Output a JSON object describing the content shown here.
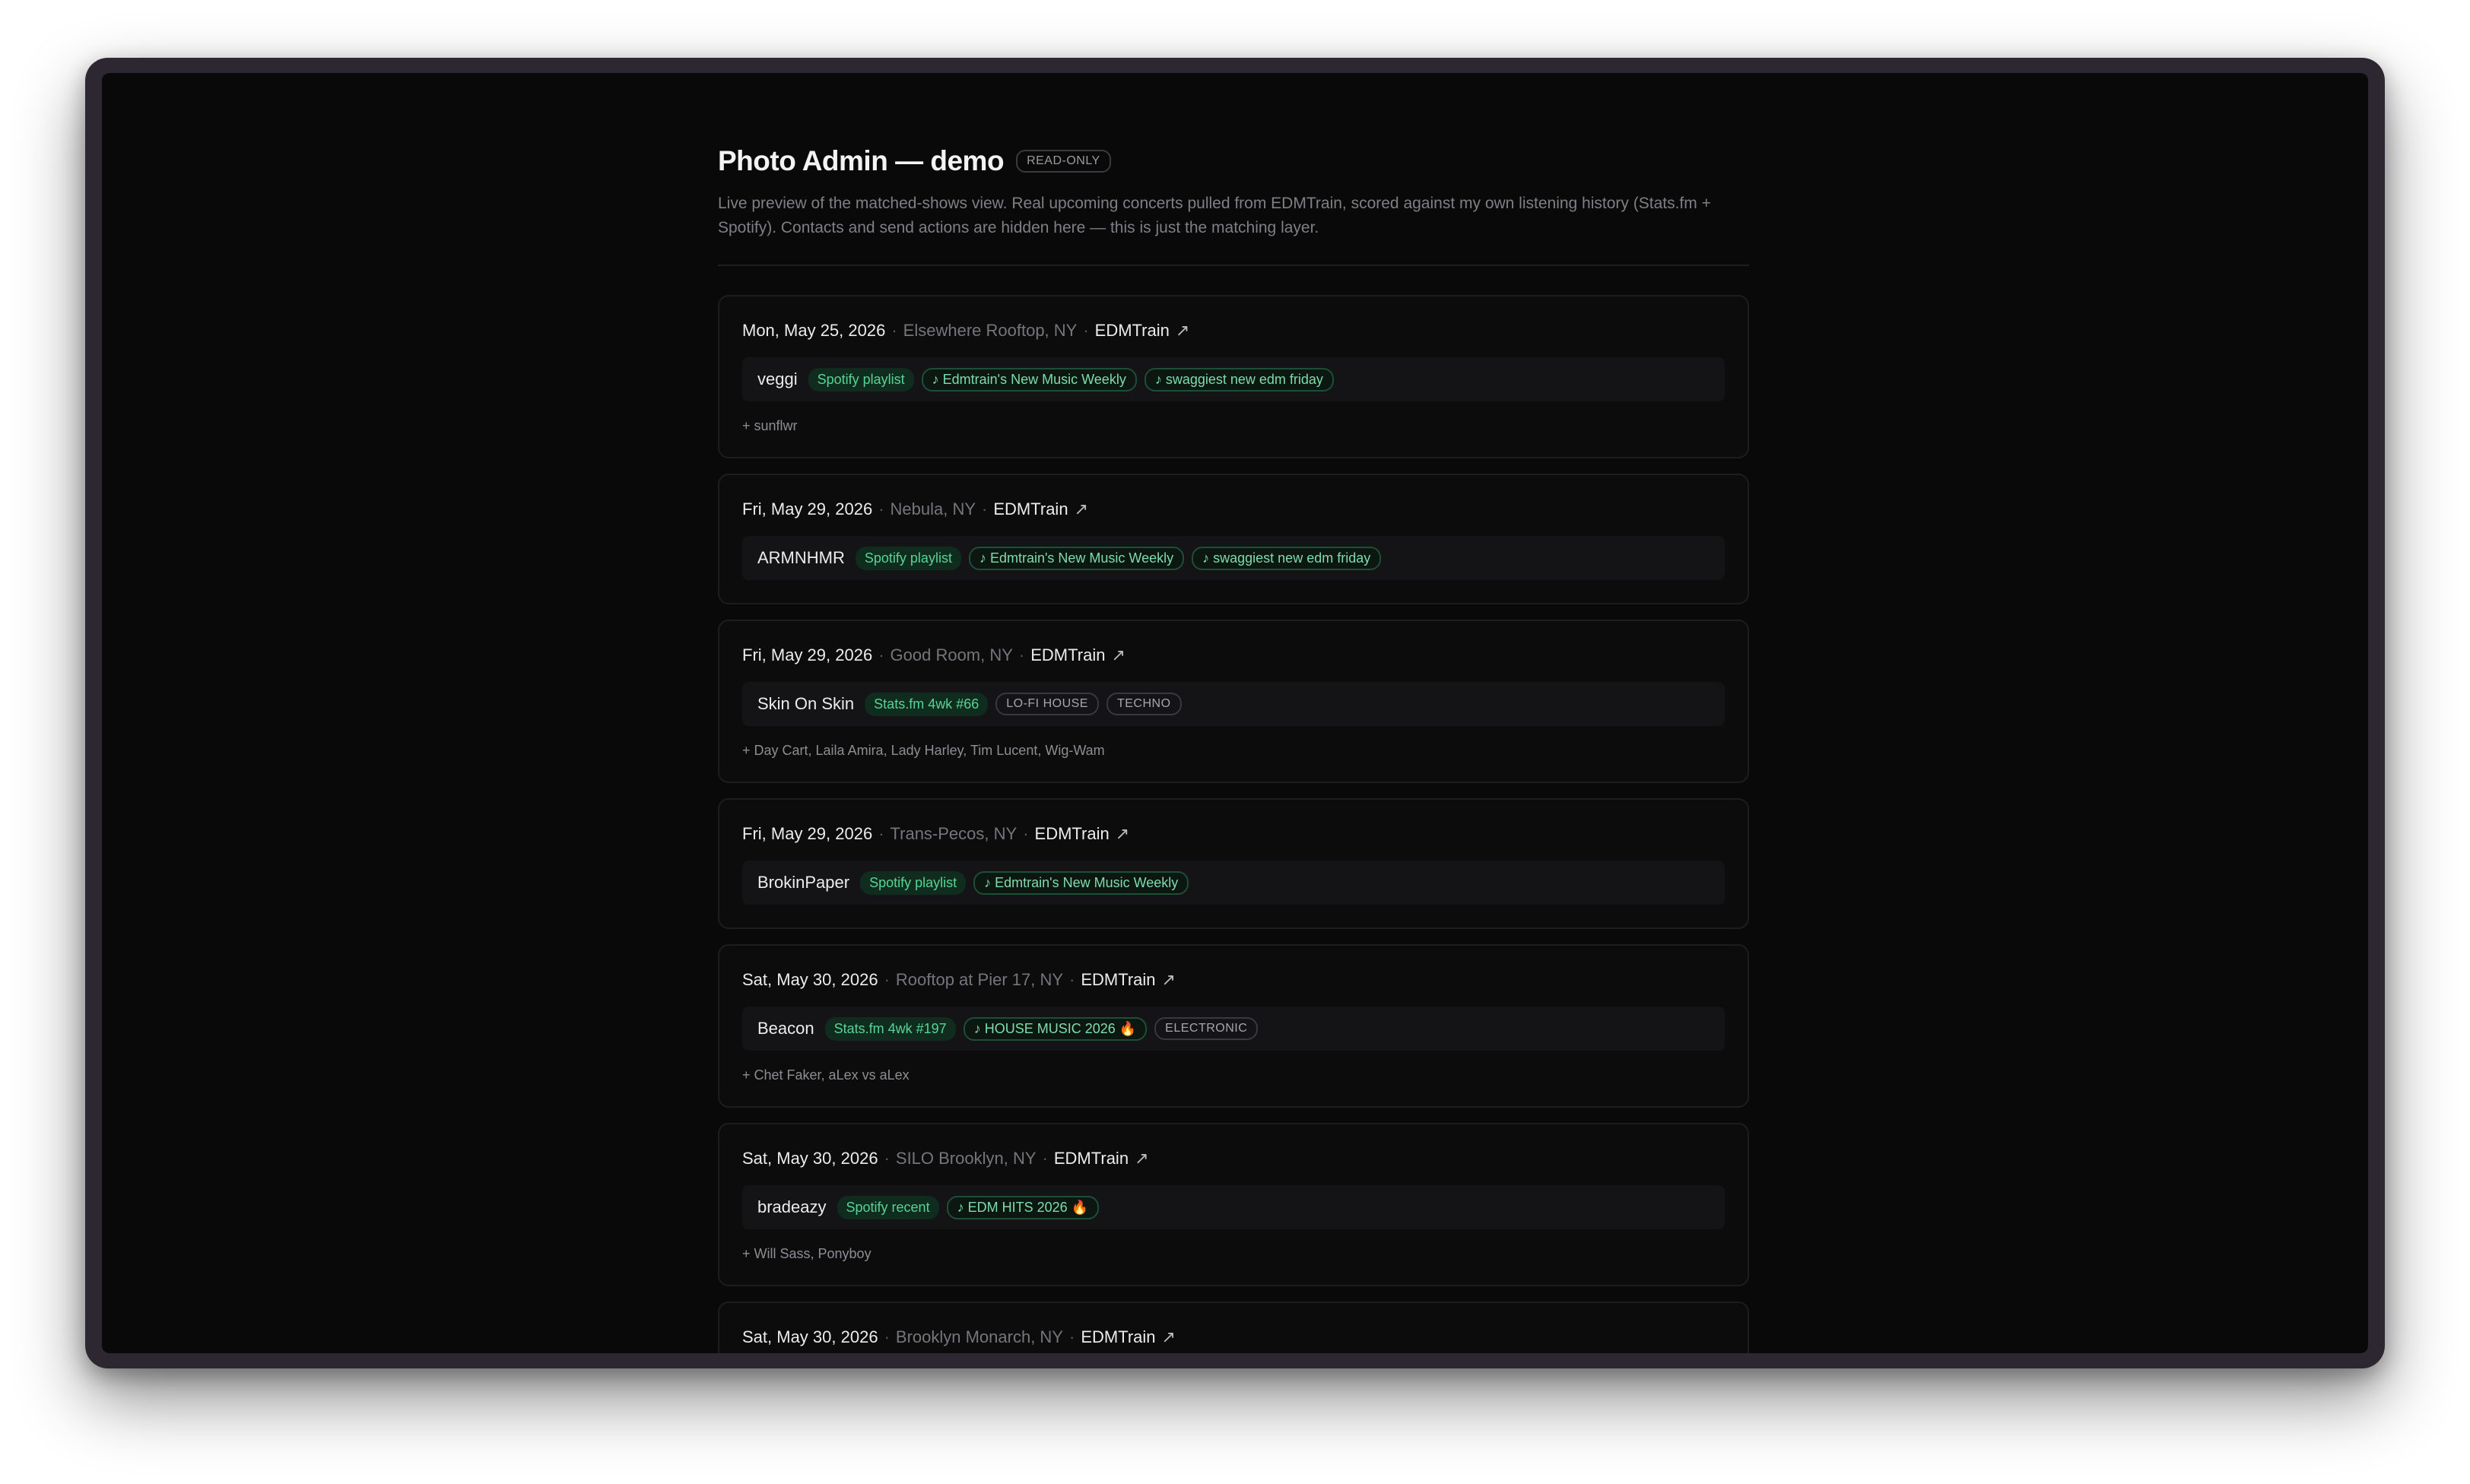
{
  "header": {
    "title": "Photo Admin — demo",
    "badge": "READ-ONLY",
    "description": "Live preview of the matched-shows view. Real upcoming concerts pulled from EDMTrain, scored against my own listening history (Stats.fm + Spotify). Contacts and send actions are hidden here — this is just the matching layer."
  },
  "icons": {
    "external_link": "external-link-icon",
    "note": "music-note-icon"
  },
  "colors": {
    "background": "#09090a",
    "accent_green": "#57d495"
  },
  "shows": [
    {
      "date": "Mon, May 25, 2026",
      "venue": "Elsewhere Rooftop, NY",
      "source": "EDMTrain",
      "link_glyph": "↗",
      "artist": "veggi",
      "tags": [
        {
          "kind": "src-tag",
          "text": "Spotify playlist"
        },
        {
          "kind": "pl-tag",
          "text": "♪ Edmtrain's New Music Weekly"
        },
        {
          "kind": "pl-tag",
          "text": "♪ swaggiest new edm friday"
        }
      ],
      "extra": "+ sunflwr"
    },
    {
      "date": "Fri, May 29, 2026",
      "venue": "Nebula, NY",
      "source": "EDMTrain",
      "link_glyph": "↗",
      "artist": "ARMNHMR",
      "tags": [
        {
          "kind": "src-tag",
          "text": "Spotify playlist"
        },
        {
          "kind": "pl-tag",
          "text": "♪ Edmtrain's New Music Weekly"
        },
        {
          "kind": "pl-tag",
          "text": "♪ swaggiest new edm friday"
        }
      ],
      "extra": ""
    },
    {
      "date": "Fri, May 29, 2026",
      "venue": "Good Room, NY",
      "source": "EDMTrain",
      "link_glyph": "↗",
      "artist": "Skin On Skin",
      "tags": [
        {
          "kind": "src-tag",
          "text": "Stats.fm 4wk #66"
        },
        {
          "kind": "genre",
          "text": "LO-FI HOUSE"
        },
        {
          "kind": "genre",
          "text": "TECHNO"
        }
      ],
      "extra": "+ Day Cart, Laila Amira, Lady Harley, Tim Lucent, Wig-Wam"
    },
    {
      "date": "Fri, May 29, 2026",
      "venue": "Trans-Pecos, NY",
      "source": "EDMTrain",
      "link_glyph": "↗",
      "artist": "BrokinPaper",
      "tags": [
        {
          "kind": "src-tag",
          "text": "Spotify playlist"
        },
        {
          "kind": "pl-tag",
          "text": "♪ Edmtrain's New Music Weekly"
        }
      ],
      "extra": ""
    },
    {
      "date": "Sat, May 30, 2026",
      "venue": "Rooftop at Pier 17, NY",
      "source": "EDMTrain",
      "link_glyph": "↗",
      "artist": "Beacon",
      "tags": [
        {
          "kind": "src-tag",
          "text": "Stats.fm 4wk #197"
        },
        {
          "kind": "pl-tag",
          "text": "♪ HOUSE MUSIC 2026 🔥"
        },
        {
          "kind": "genre",
          "text": "ELECTRONIC"
        }
      ],
      "extra": "+ Chet Faker, aLex vs aLex"
    },
    {
      "date": "Sat, May 30, 2026",
      "venue": "SILO Brooklyn, NY",
      "source": "EDMTrain",
      "link_glyph": "↗",
      "artist": "bradeazy",
      "tags": [
        {
          "kind": "src-tag",
          "text": "Spotify recent"
        },
        {
          "kind": "pl-tag",
          "text": "♪ EDM HITS 2026 🔥"
        }
      ],
      "extra": "+ Will Sass, Ponyboy"
    },
    {
      "date": "Sat, May 30, 2026",
      "venue": "Brooklyn Monarch, NY",
      "source": "EDMTrain",
      "link_glyph": "↗",
      "artist": "",
      "tags": [],
      "extra": ""
    }
  ]
}
